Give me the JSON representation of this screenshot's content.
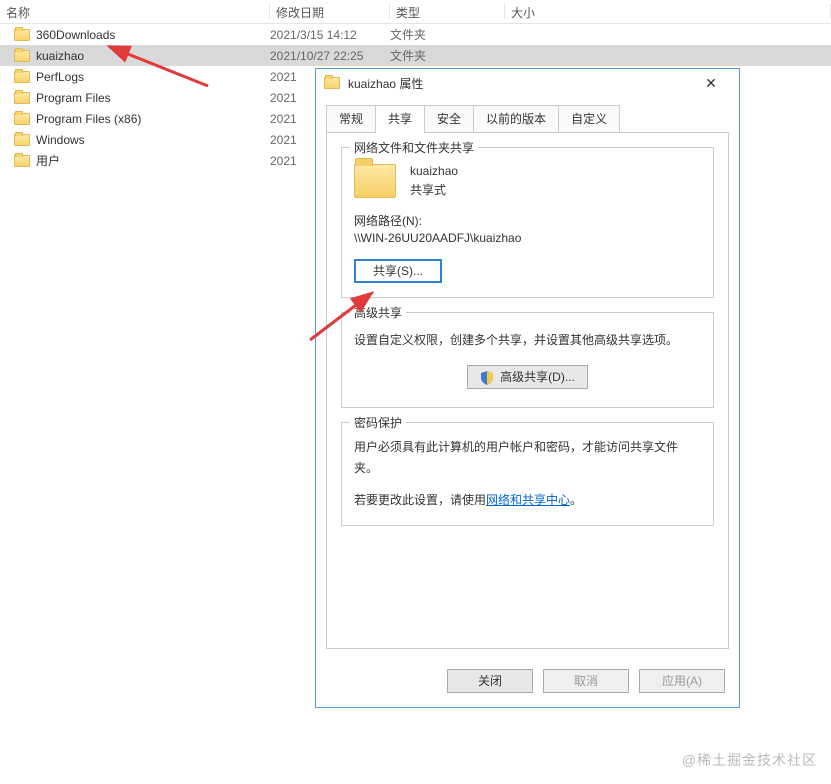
{
  "explorer": {
    "columns": {
      "name": "名称",
      "date": "修改日期",
      "type": "类型",
      "size": "大小"
    },
    "rows": [
      {
        "name": "360Downloads",
        "date": "2021/3/15 14:12",
        "type": "文件夹"
      },
      {
        "name": "kuaizhao",
        "date": "2021/10/27 22:25",
        "type": "文件夹",
        "selected": true
      },
      {
        "name": "PerfLogs",
        "date": "2021",
        "type": ""
      },
      {
        "name": "Program Files",
        "date": "2021",
        "type": ""
      },
      {
        "name": "Program Files (x86)",
        "date": "2021",
        "type": ""
      },
      {
        "name": "Windows",
        "date": "2021",
        "type": ""
      },
      {
        "name": "用户",
        "date": "2021",
        "type": ""
      }
    ]
  },
  "dialog": {
    "title": "kuaizhao 属性",
    "tabs": {
      "general": "常规",
      "sharing": "共享",
      "security": "安全",
      "previous": "以前的版本",
      "custom": "自定义"
    },
    "sharing": {
      "group_title": "网络文件和文件夹共享",
      "folder_name": "kuaizhao",
      "status": "共享式",
      "netpath_label": "网络路径(N):",
      "netpath": "\\\\WIN-26UU20AADFJ\\kuaizhao",
      "share_btn": "共享(S)..."
    },
    "advanced": {
      "group_title": "高级共享",
      "desc": "设置自定义权限，创建多个共享，并设置其他高级共享选项。",
      "btn": "高级共享(D)..."
    },
    "password": {
      "group_title": "密码保护",
      "line1": "用户必须具有此计算机的用户帐户和密码，才能访问共享文件夹。",
      "line2_prefix": "若要更改此设置，请使用",
      "link": "网络和共享中心",
      "line2_suffix": "。"
    },
    "buttons": {
      "close": "关闭",
      "cancel": "取消",
      "apply": "应用(A)"
    }
  },
  "watermark": "@稀土掘金技术社区"
}
